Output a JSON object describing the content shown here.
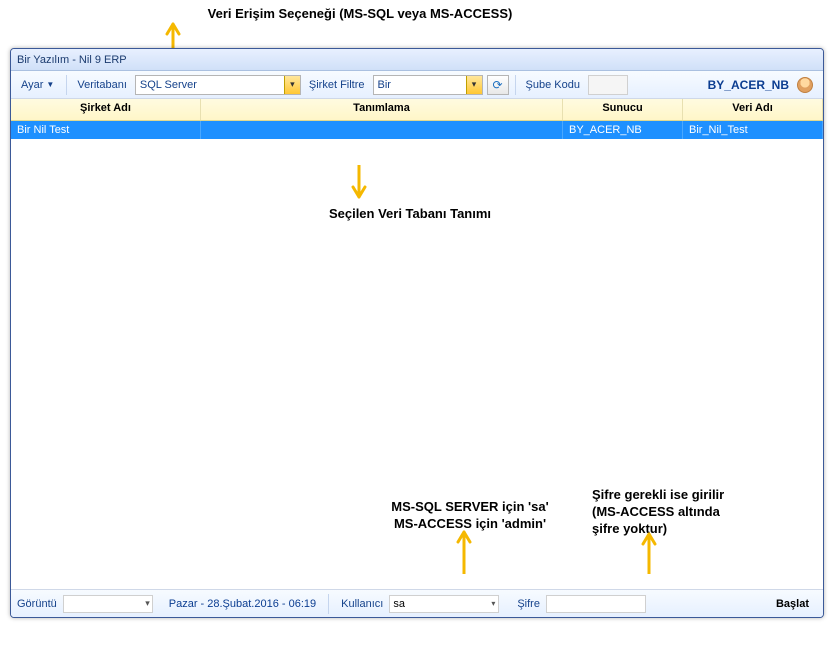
{
  "annotations": {
    "top": "Veri Erişim Seçeneği (MS-SQL veya MS-ACCESS)",
    "middle": "Seçilen Veri Tabanı Tanımı",
    "bottom_left": "MS-SQL SERVER için 'sa'\nMS-ACCESS için 'admin'",
    "bottom_right": "Şifre gerekli ise girilir\n(MS-ACCESS altında\nşifre yoktur)"
  },
  "window": {
    "title": "Bir Yazılım - Nil 9 ERP"
  },
  "toolbar": {
    "ayar": "Ayar",
    "veritabani_label": "Veritabanı",
    "veritabani_value": "SQL Server",
    "sirket_filtre_label": "Şirket Filtre",
    "sirket_filtre_value": "Bir",
    "sube_kodu_label": "Şube Kodu",
    "sube_kodu_value": "",
    "machine": "BY_ACER_NB"
  },
  "table": {
    "headers": [
      "Şirket Adı",
      "Tanımlama",
      "Sunucu",
      "Veri Adı"
    ],
    "row": {
      "sirket": "Bir Nil Test",
      "tanim": "",
      "sunucu": "BY_ACER_NB",
      "veri": "Bir_Nil_Test"
    }
  },
  "bottom": {
    "goruntu_label": "Görüntü",
    "date": "Pazar - 28.Şubat.2016 - 06:19",
    "kullanici_label": "Kullanıcı",
    "kullanici_value": "sa",
    "sifre_label": "Şifre",
    "baslat": "Başlat"
  }
}
